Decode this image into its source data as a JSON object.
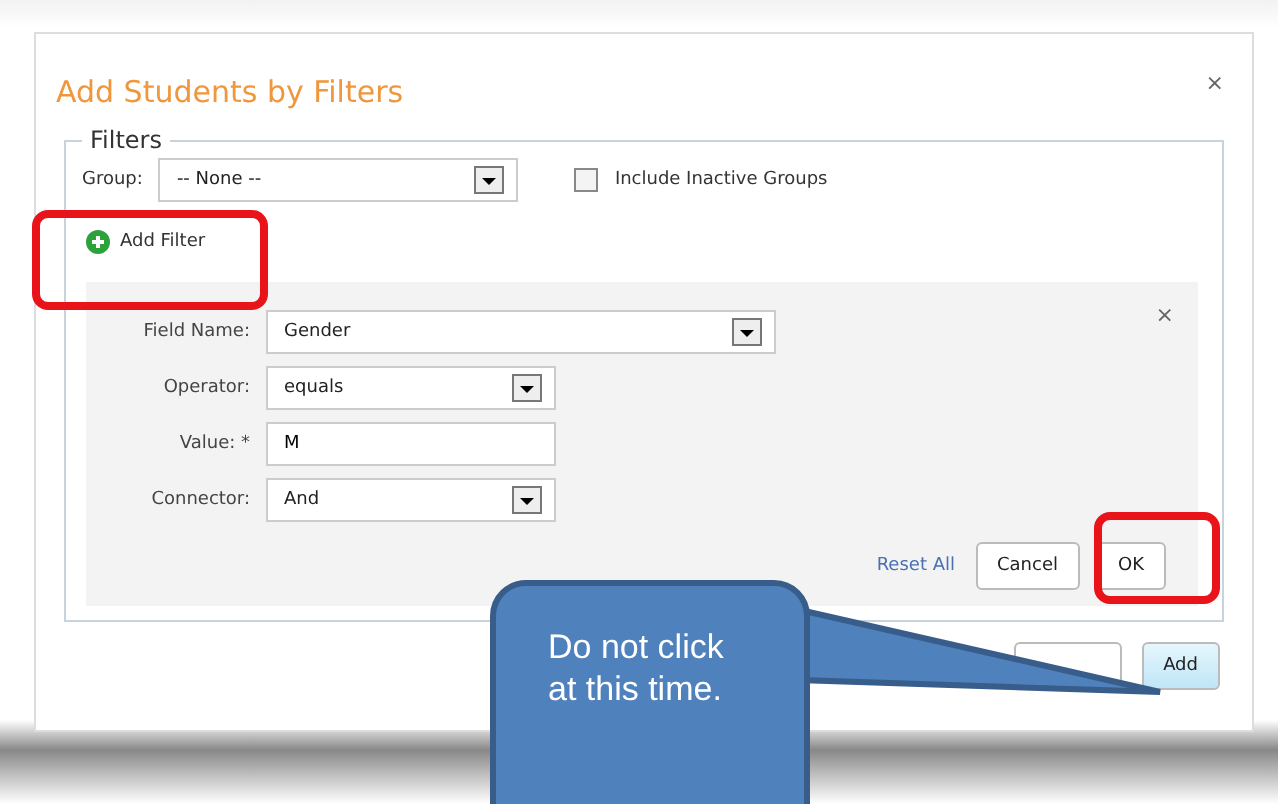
{
  "dialog": {
    "title": "Add Students by Filters",
    "close": "×"
  },
  "filters": {
    "legend": "Filters",
    "group_label": "Group:",
    "group_value": "-- None --",
    "include_inactive": {
      "label": "Include Inactive Groups",
      "checked": false
    },
    "add_filter": "Add Filter"
  },
  "filter_panel": {
    "close": "×",
    "rows": [
      {
        "label": "Field Name:",
        "value": "Gender",
        "kind": "select"
      },
      {
        "label": "Operator:",
        "value": "equals",
        "kind": "select"
      },
      {
        "label": "Value: *",
        "value": "M",
        "kind": "text"
      },
      {
        "label": "Connector:",
        "value": "And",
        "kind": "select"
      }
    ],
    "reset": "Reset All",
    "cancel": "Cancel",
    "ok": "OK"
  },
  "footer": {
    "add": "Add"
  },
  "callout": {
    "text": "Do not click at this time."
  }
}
